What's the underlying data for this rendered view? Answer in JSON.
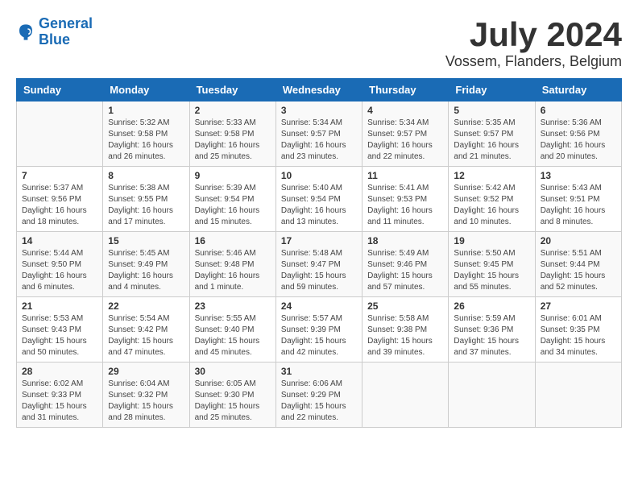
{
  "header": {
    "logo_line1": "General",
    "logo_line2": "Blue",
    "month": "July 2024",
    "location": "Vossem, Flanders, Belgium"
  },
  "weekdays": [
    "Sunday",
    "Monday",
    "Tuesday",
    "Wednesday",
    "Thursday",
    "Friday",
    "Saturday"
  ],
  "weeks": [
    [
      {
        "day": "",
        "info": ""
      },
      {
        "day": "1",
        "info": "Sunrise: 5:32 AM\nSunset: 9:58 PM\nDaylight: 16 hours\nand 26 minutes."
      },
      {
        "day": "2",
        "info": "Sunrise: 5:33 AM\nSunset: 9:58 PM\nDaylight: 16 hours\nand 25 minutes."
      },
      {
        "day": "3",
        "info": "Sunrise: 5:34 AM\nSunset: 9:57 PM\nDaylight: 16 hours\nand 23 minutes."
      },
      {
        "day": "4",
        "info": "Sunrise: 5:34 AM\nSunset: 9:57 PM\nDaylight: 16 hours\nand 22 minutes."
      },
      {
        "day": "5",
        "info": "Sunrise: 5:35 AM\nSunset: 9:57 PM\nDaylight: 16 hours\nand 21 minutes."
      },
      {
        "day": "6",
        "info": "Sunrise: 5:36 AM\nSunset: 9:56 PM\nDaylight: 16 hours\nand 20 minutes."
      }
    ],
    [
      {
        "day": "7",
        "info": "Sunrise: 5:37 AM\nSunset: 9:56 PM\nDaylight: 16 hours\nand 18 minutes."
      },
      {
        "day": "8",
        "info": "Sunrise: 5:38 AM\nSunset: 9:55 PM\nDaylight: 16 hours\nand 17 minutes."
      },
      {
        "day": "9",
        "info": "Sunrise: 5:39 AM\nSunset: 9:54 PM\nDaylight: 16 hours\nand 15 minutes."
      },
      {
        "day": "10",
        "info": "Sunrise: 5:40 AM\nSunset: 9:54 PM\nDaylight: 16 hours\nand 13 minutes."
      },
      {
        "day": "11",
        "info": "Sunrise: 5:41 AM\nSunset: 9:53 PM\nDaylight: 16 hours\nand 11 minutes."
      },
      {
        "day": "12",
        "info": "Sunrise: 5:42 AM\nSunset: 9:52 PM\nDaylight: 16 hours\nand 10 minutes."
      },
      {
        "day": "13",
        "info": "Sunrise: 5:43 AM\nSunset: 9:51 PM\nDaylight: 16 hours\nand 8 minutes."
      }
    ],
    [
      {
        "day": "14",
        "info": "Sunrise: 5:44 AM\nSunset: 9:50 PM\nDaylight: 16 hours\nand 6 minutes."
      },
      {
        "day": "15",
        "info": "Sunrise: 5:45 AM\nSunset: 9:49 PM\nDaylight: 16 hours\nand 4 minutes."
      },
      {
        "day": "16",
        "info": "Sunrise: 5:46 AM\nSunset: 9:48 PM\nDaylight: 16 hours\nand 1 minute."
      },
      {
        "day": "17",
        "info": "Sunrise: 5:48 AM\nSunset: 9:47 PM\nDaylight: 15 hours\nand 59 minutes."
      },
      {
        "day": "18",
        "info": "Sunrise: 5:49 AM\nSunset: 9:46 PM\nDaylight: 15 hours\nand 57 minutes."
      },
      {
        "day": "19",
        "info": "Sunrise: 5:50 AM\nSunset: 9:45 PM\nDaylight: 15 hours\nand 55 minutes."
      },
      {
        "day": "20",
        "info": "Sunrise: 5:51 AM\nSunset: 9:44 PM\nDaylight: 15 hours\nand 52 minutes."
      }
    ],
    [
      {
        "day": "21",
        "info": "Sunrise: 5:53 AM\nSunset: 9:43 PM\nDaylight: 15 hours\nand 50 minutes."
      },
      {
        "day": "22",
        "info": "Sunrise: 5:54 AM\nSunset: 9:42 PM\nDaylight: 15 hours\nand 47 minutes."
      },
      {
        "day": "23",
        "info": "Sunrise: 5:55 AM\nSunset: 9:40 PM\nDaylight: 15 hours\nand 45 minutes."
      },
      {
        "day": "24",
        "info": "Sunrise: 5:57 AM\nSunset: 9:39 PM\nDaylight: 15 hours\nand 42 minutes."
      },
      {
        "day": "25",
        "info": "Sunrise: 5:58 AM\nSunset: 9:38 PM\nDaylight: 15 hours\nand 39 minutes."
      },
      {
        "day": "26",
        "info": "Sunrise: 5:59 AM\nSunset: 9:36 PM\nDaylight: 15 hours\nand 37 minutes."
      },
      {
        "day": "27",
        "info": "Sunrise: 6:01 AM\nSunset: 9:35 PM\nDaylight: 15 hours\nand 34 minutes."
      }
    ],
    [
      {
        "day": "28",
        "info": "Sunrise: 6:02 AM\nSunset: 9:33 PM\nDaylight: 15 hours\nand 31 minutes."
      },
      {
        "day": "29",
        "info": "Sunrise: 6:04 AM\nSunset: 9:32 PM\nDaylight: 15 hours\nand 28 minutes."
      },
      {
        "day": "30",
        "info": "Sunrise: 6:05 AM\nSunset: 9:30 PM\nDaylight: 15 hours\nand 25 minutes."
      },
      {
        "day": "31",
        "info": "Sunrise: 6:06 AM\nSunset: 9:29 PM\nDaylight: 15 hours\nand 22 minutes."
      },
      {
        "day": "",
        "info": ""
      },
      {
        "day": "",
        "info": ""
      },
      {
        "day": "",
        "info": ""
      }
    ]
  ]
}
